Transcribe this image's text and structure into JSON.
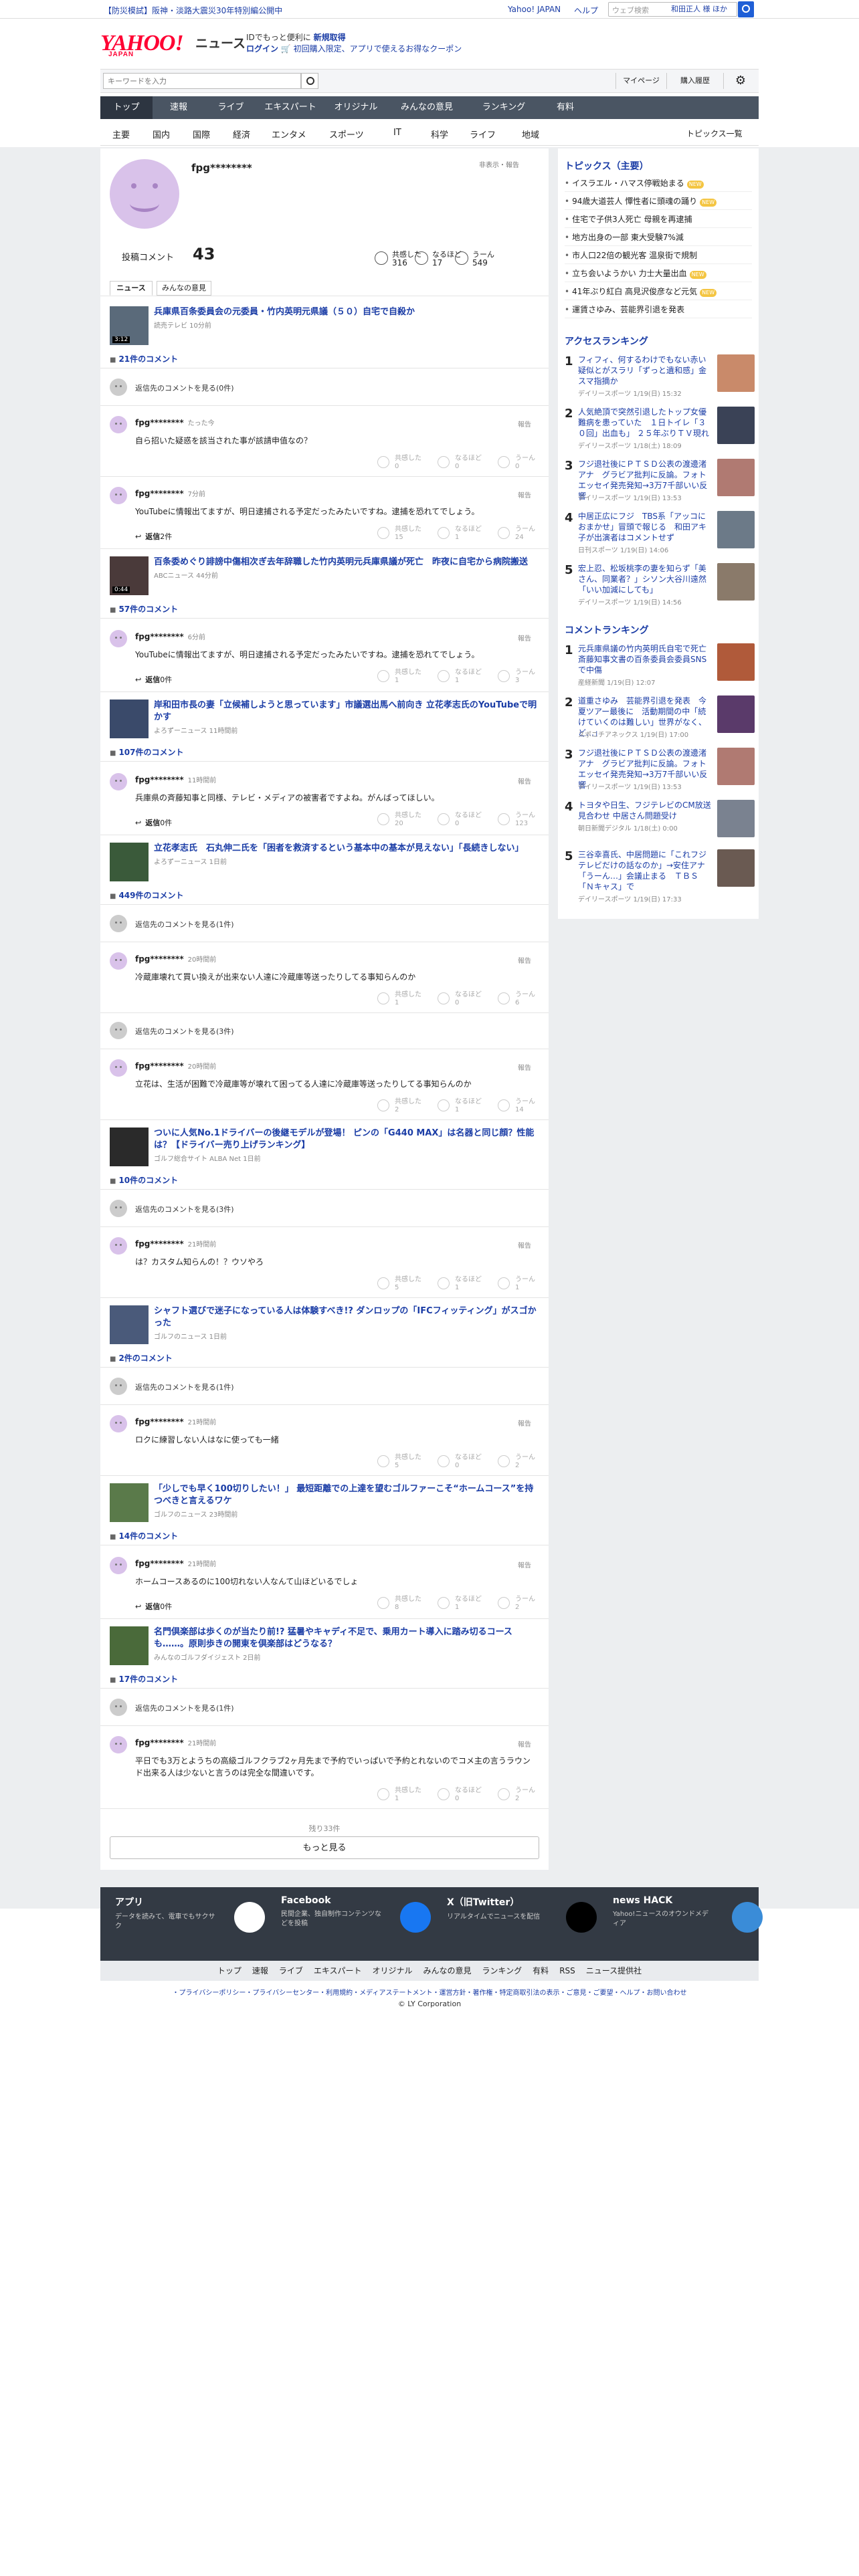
{
  "banner": {
    "alert": "【防災模試】阪神・淡路大震災30年特別編公開中",
    "yahoo_japan": "Yahoo! JAPAN",
    "help": "ヘルプ",
    "search_placeholder": "ウェブ検索",
    "user": "和田正人 様 ほか"
  },
  "logo": {
    "text": "YAHOO!",
    "sub": "JAPAN",
    "section": "ニュース"
  },
  "promo": {
    "line1_a": "IDでもっと便利に",
    "line1_b": "新規取得",
    "line2_a": "ログイン",
    "line2_b": "初回購入限定、アプリで使えるお得なクーポン"
  },
  "search": {
    "placeholder": "キーワードを入力",
    "mypage": "マイページ",
    "history": "購入履歴"
  },
  "nav1": [
    "トップ",
    "速報",
    "ライブ",
    "エキスパート",
    "オリジナル",
    "みんなの意見",
    "ランキング",
    "有料"
  ],
  "nav2": [
    "主要",
    "国内",
    "国際",
    "経済",
    "エンタメ",
    "スポーツ",
    "IT",
    "科学",
    "ライフ",
    "地域"
  ],
  "nav2_all": "トピックス一覧",
  "profile": {
    "name": "fpg********",
    "hidden_link": "非表示・報告",
    "comment_label": "投稿コメント",
    "comment_count": "43",
    "stats": [
      {
        "label": "共感した",
        "value": "316"
      },
      {
        "label": "なるほど",
        "value": "17"
      },
      {
        "label": "うーん",
        "value": "549"
      }
    ],
    "tabs": [
      "ニュース",
      "みんなの意見"
    ]
  },
  "react_labels": [
    "共感した",
    "なるほど",
    "うーん"
  ],
  "report": "報告",
  "prev_comment": "返信先のコメントを見る",
  "reply_label": "返信",
  "articles": [
    {
      "title": "兵庫県百条委員会の元委員・竹内英明元県議（５０）自宅で自殺か",
      "source": "読売テレビ 10分前",
      "duration": "3:12",
      "count": "21件のコメント",
      "comments": [
        {
          "type": "prev",
          "text": "返信先のコメントを見る(0件)"
        },
        {
          "name": "fpg********",
          "time": "たった今",
          "body": "自ら招いた疑惑を該当された事が該請申值なの？",
          "r": [
            "0",
            "0",
            "0"
          ]
        },
        {
          "name": "fpg********",
          "time": "7分前",
          "body": "YouTubeに情報出てますが、明日逮捕される予定だったみたいですね。逮捕を恐れてでしょう。",
          "r": [
            "15",
            "1",
            "24"
          ],
          "reply": "2件"
        }
      ]
    },
    {
      "title": "百条委めぐり誹謗中傷相次ぎ去年辞職した竹内英明元兵庫県議が死亡　昨夜に自宅から病院搬送",
      "source": "ABCニュース 44分前",
      "duration": "0:44",
      "count": "57件のコメント",
      "comments": [
        {
          "name": "fpg********",
          "time": "6分前",
          "body": "YouTubeに情報出てますが、明日逮捕される予定だったみたいですね。逮捕を恐れてでしょう。",
          "r": [
            "1",
            "1",
            "3"
          ],
          "reply": "0件"
        }
      ]
    },
    {
      "title": "岸和田市長の妻「立候補しようと思っています」市議選出馬へ前向き 立花孝志氏のYouTubeで明かす",
      "source": "よろずーニュース 11時間前",
      "count": "107件のコメント",
      "comments": [
        {
          "name": "fpg********",
          "time": "11時間前",
          "body": "兵庫県の斉藤知事と同様、テレビ・メディアの被害者ですよね。がんばってほしい。",
          "r": [
            "20",
            "0",
            "123"
          ],
          "reply": "0件"
        }
      ]
    },
    {
      "title": "立花孝志氏　石丸伸二氏を「困者を救済するという基本中の基本が見えない」「長続きしない」",
      "source": "よろずーニュース 1日前",
      "count": "449件のコメント",
      "comments": [
        {
          "type": "prev",
          "text": "返信先のコメントを見る(1件)"
        },
        {
          "name": "fpg********",
          "time": "20時間前",
          "body": "冷蔵庫壊れて買い換えが出来ない人達に冷蔵庫等送ったりしてる事知らんのか",
          "r": [
            "1",
            "0",
            "6"
          ]
        },
        {
          "type": "prev",
          "text": "返信先のコメントを見る(3件)"
        },
        {
          "name": "fpg********",
          "time": "20時間前",
          "body": "立花は、生活が困難で冷蔵庫等が壊れて困ってる人達に冷蔵庫等送ったりしてる事知らんのか",
          "r": [
            "2",
            "1",
            "14"
          ]
        }
      ]
    },
    {
      "title": "ついに人気No.1ドライバーの後継モデルが登場！ ピンの「G440 MAX」は名器と同じ顔？性能は？【ドライバー売り上げランキング】",
      "source": "ゴルフ総合サイト ALBA Net 1日前",
      "count": "10件のコメント",
      "comments": [
        {
          "type": "prev",
          "text": "返信先のコメントを見る(3件)"
        },
        {
          "name": "fpg********",
          "time": "21時間前",
          "body": "は？カスタム知らんの！？ウソやろ",
          "r": [
            "5",
            "1",
            "1"
          ]
        }
      ]
    },
    {
      "title": "シャフト選びで迷子になっている人は体験すべき!? ダンロップの「IFCフィッティング」がスゴかった",
      "source": "ゴルフのニュース 1日前",
      "count": "2件のコメント",
      "comments": [
        {
          "type": "prev",
          "text": "返信先のコメントを見る(1件)"
        },
        {
          "name": "fpg********",
          "time": "21時間前",
          "body": "ロクに練習しない人はなに使っても一緒",
          "r": [
            "5",
            "0",
            "2"
          ]
        }
      ]
    },
    {
      "title": "「少しでも早く100切りしたい！」 最短距離での上達を望むゴルファーこそ“ホームコース”を持つべきと言えるワケ",
      "source": "ゴルフのニュース 23時間前",
      "count": "14件のコメント",
      "comments": [
        {
          "name": "fpg********",
          "time": "21時間前",
          "body": "ホームコースあるのに100切れない人なんて山ほどいるでしょ",
          "r": [
            "8",
            "1",
            "2"
          ],
          "reply": "0件"
        }
      ]
    },
    {
      "title": "名門倶楽部は歩くのが当たり前!? 猛暑やキャディ不足で、乗用カート導入に踏み切るコースも……。原則歩きの開東を倶楽部はどうなる？",
      "source": "みんなのゴルフダイジェスト 2日前",
      "count": "17件のコメント",
      "comments": [
        {
          "type": "prev",
          "text": "返信先のコメントを見る(1件)"
        },
        {
          "name": "fpg********",
          "time": "21時間前",
          "body": "平日でも3万とようちの高級ゴルフクラブ2ヶ月先まで予約でいっぱいで予約とれないのでコメ主の言うラウンド出来る人は少ないと言うのは完全な間違いです。",
          "r": [
            "1",
            "0",
            "2"
          ]
        }
      ]
    }
  ],
  "more": {
    "remain": "残り33件",
    "button": "もっと見る"
  },
  "side": {
    "topics_header": "トピックス（主要）",
    "topics": [
      {
        "t": "イスラエル・ハマス停戦始まる",
        "n": true
      },
      {
        "t": "94歳大道芸人 憚性者に頭魂の踊り",
        "n": true
      },
      {
        "t": "住宅で子供3人死亡 母親を再逮捕",
        "n": false
      },
      {
        "t": "地方出身の一部 東大受験7%減",
        "n": false
      },
      {
        "t": "市人口22倍の観光客 温泉街で規制",
        "n": false
      },
      {
        "t": "立ち会いようかい 力士大量出血",
        "n": true
      },
      {
        "t": "41年ぶり紅白 高見沢俊彦など元気",
        "n": true
      },
      {
        "t": "運賃さゆみ、芸能界引退を発表",
        "n": false
      }
    ],
    "access_header": "アクセスランキング",
    "access": [
      {
        "t": "フィフィ、何するわけでもない赤い疑似とがスラリ「ずっと遺和感」金スマ指摘か",
        "s": "デイリースポーツ 1/19(日) 15:32",
        "c": "#c98a6a"
      },
      {
        "t": "人気絶頂で突然引退したトップ女優　難病を患っていた　１日トイレ「３０回」出血も」 ２５年ぶりＴＶ現れ",
        "s": "デイリースポーツ 1/18(土) 18:09",
        "c": "#3a4256"
      },
      {
        "t": "フジ退社後にＰＴＳＤ公表の渡邊渚アナ　グラビア批判に反論。フォトエッセイ発売発知→3万7千部いい反響",
        "s": "デイリースポーツ 1/19(日) 13:53",
        "c": "#b07a72"
      },
      {
        "t": "中居正広にフジ　TBS系「アッコにおまかせ」冒頭で報じる　和田アキ子が出演者はコメントせず",
        "s": "日刊スポーツ 1/19(日) 14:06",
        "c": "#6c7a88"
      },
      {
        "t": "宏上忍、松坂桃李の妻を知らず「美さん、同業者？」シソン大谷川遠然「いい加減にしても」",
        "s": "デイリースポーツ 1/19(日) 14:56",
        "c": "#8a7a6a"
      }
    ],
    "comment_header": "コメントランキング",
    "comment_rank": [
      {
        "t": "元兵庫県議の竹内英明氏自宅で死亡　斎藤知事文書の百条委員会委員SNSで中傷",
        "s": "産経新聞 1/19(日) 12:07",
        "c": "#b05a3a"
      },
      {
        "t": "道重さゆみ　芸能界引退を発表　今夏ツアー最後に　活動期間の中「続けていくのは難しい」世界がなく、ど…」",
        "s": "スポニチアネックス 1/19(日) 17:00",
        "c": "#5a3a6a"
      },
      {
        "t": "フジ退社後にＰＴＳＤ公表の渡邊渚アナ　グラビア批判に反論。フォトエッセイ発売発知→3万7千部いい反響",
        "s": "デイリースポーツ 1/19(日) 13:53",
        "c": "#b07a72"
      },
      {
        "t": "トヨタや日生、フジテレビのCM放送見合わせ 中居さん問題受け",
        "s": "朝日新聞デジタル 1/18(土) 0:00",
        "c": "#7a8290"
      },
      {
        "t": "三谷幸喜氏、中居問題に「これフジテレビだけの話なのか」→安住アナ「うーん…」会議止まる　ＴＢＳ「Ｎキャス」で",
        "s": "デイリースポーツ 1/19(日) 17:33",
        "c": "#6a5a52"
      }
    ]
  },
  "footer": {
    "cols": [
      {
        "t": "アプリ",
        "d": "データを読みて、電車でもサクサク"
      },
      {
        "t": "Facebook",
        "d": "民間企業、独自制作コンテンツなどを投稿"
      },
      {
        "t": "X（旧Twitter）",
        "d": "リアルタイムでニュースを配信"
      },
      {
        "t": "news HACK",
        "d": "Yahoo!ニュースのオウンドメディア"
      }
    ],
    "nav": [
      "トップ",
      "速報",
      "ライブ",
      "エキスパート",
      "オリジナル",
      "みんなの意見",
      "ランキング",
      "有料",
      "RSS",
      "ニュース提供社"
    ],
    "links": "・プライバシーポリシー・プライバシーセンター・利用規約・メディアステートメント・運営方針・著作権・特定商取引法の表示・ご意見・ご要望・ヘルプ・お問い合わせ",
    "copyright": "© LY Corporation"
  }
}
